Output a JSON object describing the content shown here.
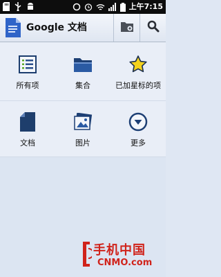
{
  "status_bar": {
    "time": "上午7:15",
    "left_icons": [
      "sd-card-icon",
      "usb-icon",
      "android-debug-icon"
    ],
    "right_icons": [
      "sync-icon",
      "alarm-icon",
      "wifi-icon",
      "signal-icon",
      "battery-icon"
    ]
  },
  "action_bar": {
    "title": "Google 文档",
    "app_icon": "docs-icon",
    "buttons": [
      {
        "icon": "folder-icon"
      },
      {
        "icon": "search-icon"
      }
    ]
  },
  "home_grid": {
    "row1": [
      {
        "label": "所有项",
        "icon": "list-icon"
      },
      {
        "label": "集合",
        "icon": "folder-icon"
      },
      {
        "label": "已加星标的项",
        "icon": "star-icon"
      }
    ],
    "row2": [
      {
        "label": "文档",
        "icon": "document-icon"
      },
      {
        "label": "图片",
        "icon": "picture-icon"
      },
      {
        "label": "更多",
        "icon": "more-icon"
      }
    ]
  },
  "watermark": {
    "cn": "手机中国",
    "en": "CNMO.com"
  },
  "colors": {
    "accent_blue": "#2a4f8a",
    "star_yellow": "#f4d21c",
    "watermark_red": "#d0231b"
  }
}
